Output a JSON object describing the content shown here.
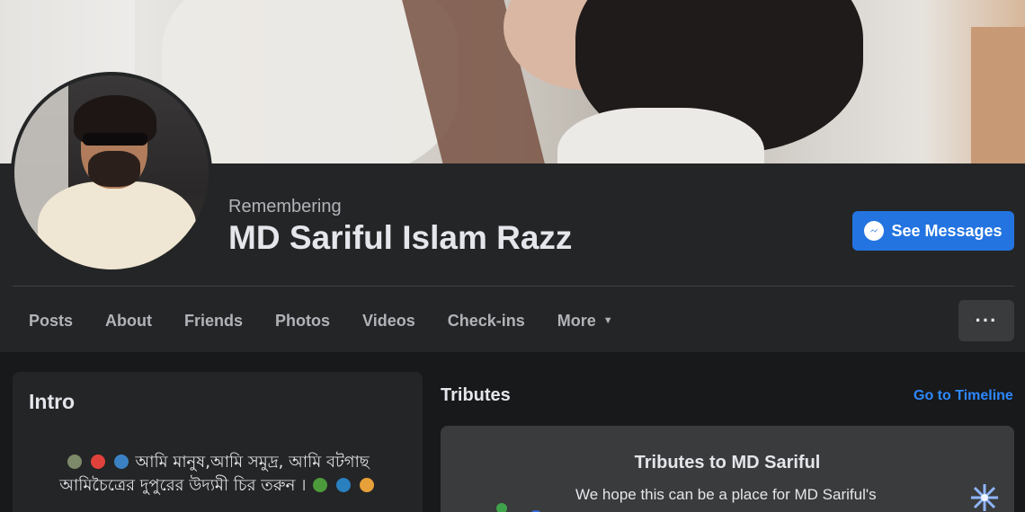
{
  "profile": {
    "remembering_label": "Remembering",
    "name": "MD Sariful Islam Razz"
  },
  "actions": {
    "see_messages_label": "See Messages"
  },
  "tabs": [
    {
      "label": "Posts"
    },
    {
      "label": "About"
    },
    {
      "label": "Friends"
    },
    {
      "label": "Photos"
    },
    {
      "label": "Videos"
    },
    {
      "label": "Check-ins"
    },
    {
      "label": "More"
    }
  ],
  "more_menu_icon": "ellipsis-icon",
  "intro": {
    "title": "Intro",
    "bio_line1": "আমি মানুষ,আমি সমুদ্র, আমি বটগাছ",
    "bio_line2": "আমিচৈত্রের দুপুরের উদ্যমী চির তরুন ।"
  },
  "tributes": {
    "title": "Tributes",
    "go_to_timeline": "Go to Timeline",
    "card_heading": "Tributes to MD Sariful",
    "card_text": "We hope this can be a place for MD Sariful's"
  },
  "colors": {
    "page_bg": "#18191a",
    "panel_bg": "#242526",
    "primary_blue": "#2374e1",
    "link_blue": "#2d88ff",
    "secondary_text": "#b0b3b8"
  }
}
